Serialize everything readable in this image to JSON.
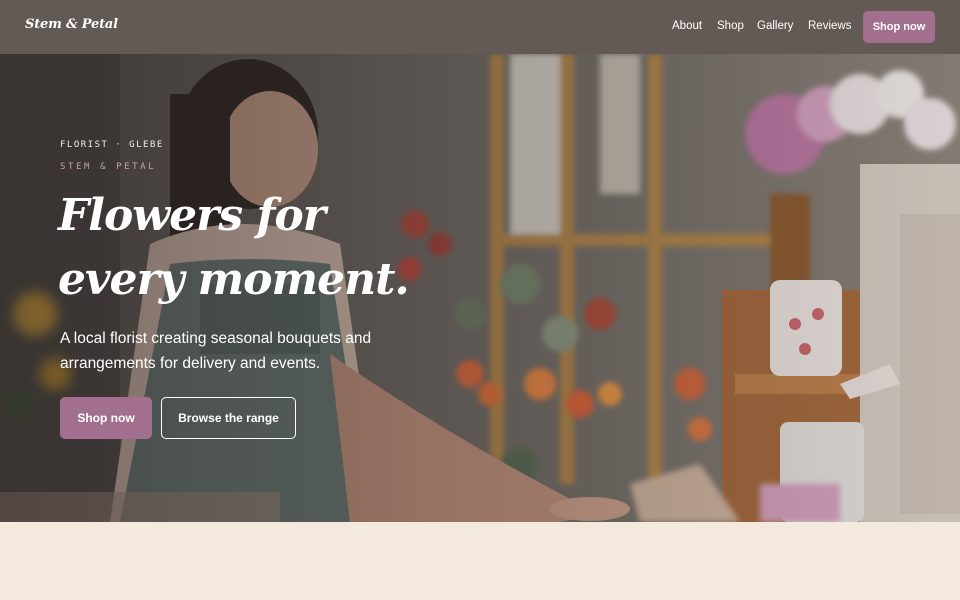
{
  "header": {
    "logo": "Stem & Petal",
    "nav": {
      "about": "About",
      "shop": "Shop",
      "gallery": "Gallery",
      "reviews": "Reviews"
    },
    "cta": "Shop now"
  },
  "hero": {
    "eyebrow": "FLORIST · GLEBE",
    "subeyebrow": "STEM & PETAL",
    "headline": "Flowers for every moment.",
    "lede": "A local florist creating seasonal bouquets and arrangements for delivery and events.",
    "primary_cta": "Shop now",
    "secondary_cta": "Browse the range"
  },
  "colors": {
    "header_bg": "#645a55",
    "accent": "#a2708e",
    "page_bg": "#f3e9dc"
  }
}
